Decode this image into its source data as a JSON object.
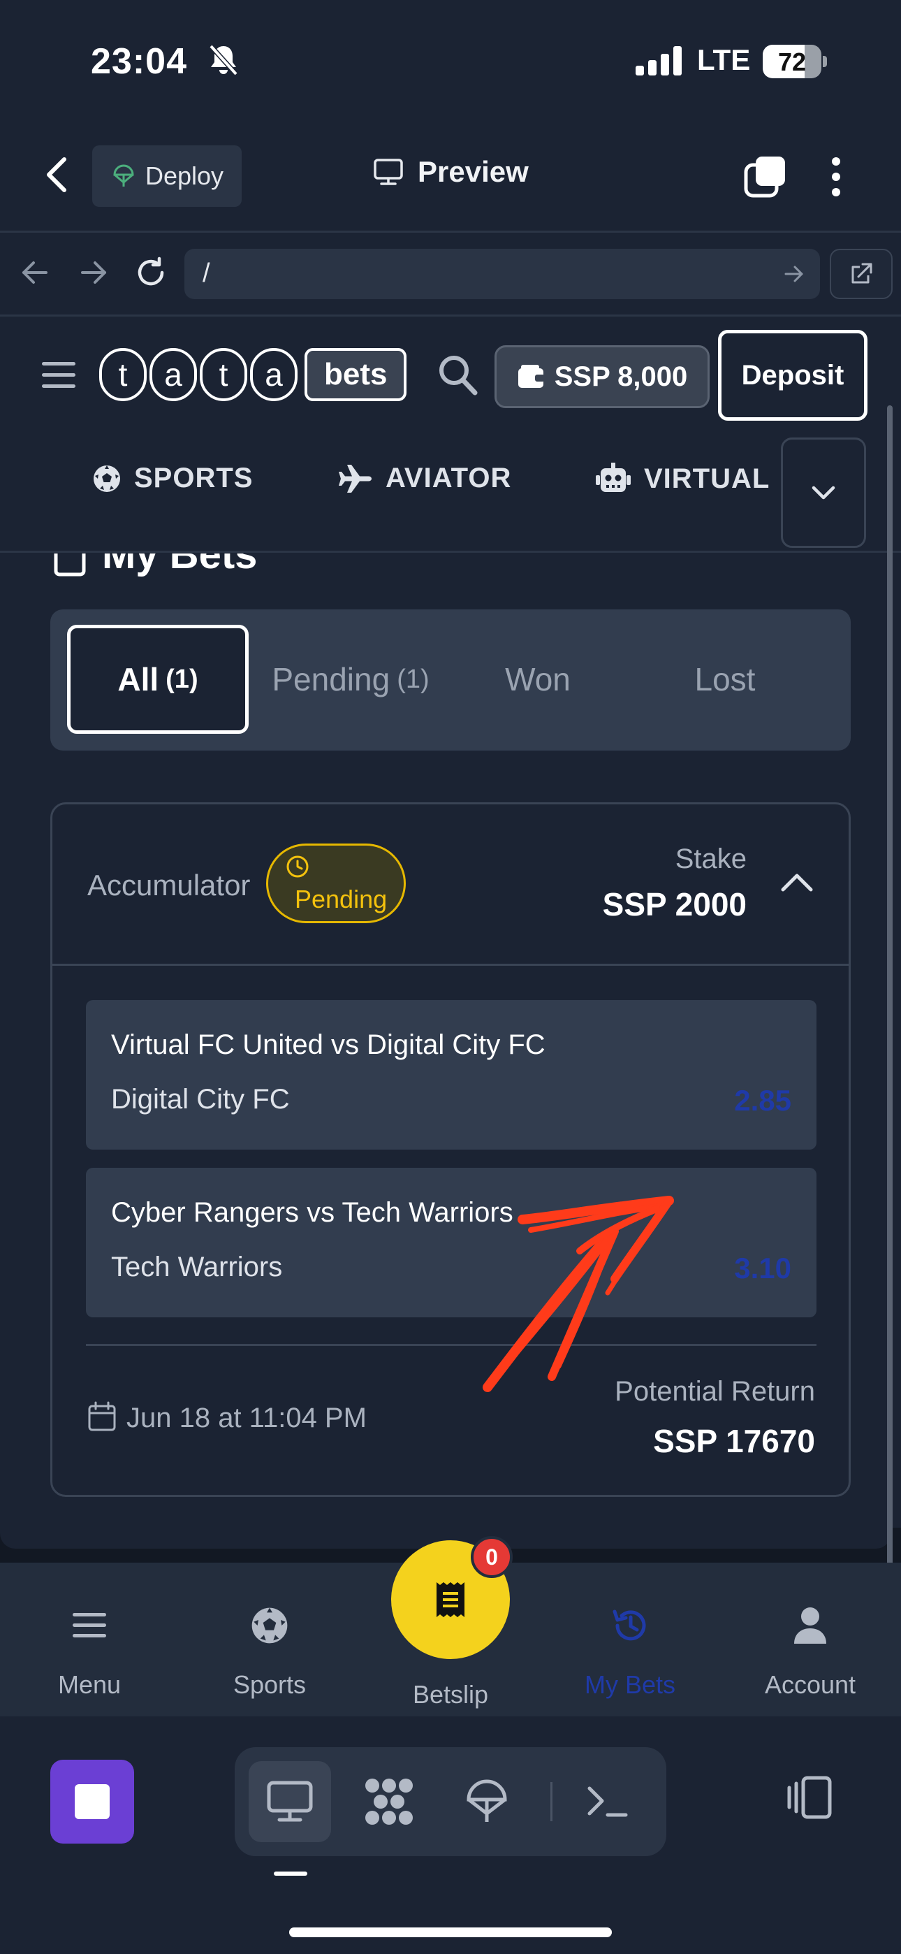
{
  "status_bar": {
    "time": "23:04",
    "network": "LTE",
    "battery": "72",
    "battery_level": 0.72
  },
  "app_toolbar": {
    "deploy_label": "Deploy",
    "preview_label": "Preview"
  },
  "browser": {
    "url": "/"
  },
  "header": {
    "logo_letters": [
      "t",
      "a",
      "t",
      "a"
    ],
    "logo_suffix": "bets",
    "balance": "SSP 8,000",
    "deposit_label": "Deposit"
  },
  "categories": [
    {
      "label": "SPORTS",
      "icon": "soccer-ball-icon"
    },
    {
      "label": "AVIATOR",
      "icon": "airplane-icon"
    },
    {
      "label": "VIRTUAL",
      "icon": "robot-icon"
    }
  ],
  "page": {
    "title": "My Bets"
  },
  "filter_tabs": [
    {
      "label": "All",
      "count": "(1)"
    },
    {
      "label": "Pending",
      "count": "(1)"
    },
    {
      "label": "Won",
      "count": ""
    },
    {
      "label": "Lost",
      "count": ""
    }
  ],
  "bet": {
    "type": "Accumulator",
    "status": "Pending",
    "stake_label": "Stake",
    "stake": "SSP 2000",
    "selections": [
      {
        "match": "Virtual FC United vs Digital City FC",
        "pick": "Digital City FC",
        "odds": "2.85"
      },
      {
        "match": "Cyber Rangers vs Tech Warriors",
        "pick": "Tech Warriors",
        "odds": "3.10"
      }
    ],
    "date": "Jun 18 at 11:04 PM",
    "return_label": "Potential Return",
    "return_value": "SSP 17670"
  },
  "bottom_nav": {
    "menu": "Menu",
    "sports": "Sports",
    "betslip": "Betslip",
    "betslip_count": "0",
    "my_bets": "My Bets",
    "account": "Account"
  },
  "colors": {
    "background": "#1b2333",
    "panel": "#323d4f",
    "pending": "#f4c20d",
    "active_nav": "#1f3aa8",
    "fab": "#f4d21d",
    "badge": "#e53935",
    "stop_button": "#6b3fd4",
    "annotation": "#ff3b1a"
  }
}
